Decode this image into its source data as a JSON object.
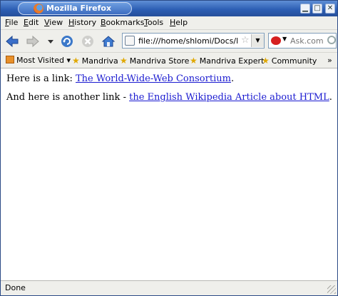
{
  "window": {
    "title": "Mozilla Firefox",
    "controls": {
      "minimize": "▁",
      "maximize": "□",
      "close": "✕"
    }
  },
  "menu": [
    "File",
    "Edit",
    "View",
    "History",
    "Bookmarks",
    "Tools",
    "Help"
  ],
  "navigation": {
    "url": "file:///home/shlomi/Docs/lectu",
    "search_placeholder": "Ask.com"
  },
  "bookmarks": [
    {
      "label": "Most Visited",
      "icon": "most-visited-icon",
      "dropdown": true
    },
    {
      "label": "Mandriva",
      "icon": "star-icon"
    },
    {
      "label": "Mandriva Store",
      "icon": "star-icon"
    },
    {
      "label": "Mandriva Expert",
      "icon": "star-icon"
    },
    {
      "label": "Community",
      "icon": "star-icon"
    }
  ],
  "bookmarks_overflow": "»",
  "content": {
    "line1": {
      "prefix": "Here is a link: ",
      "link": "The World-Wide-Web Consortium",
      "suffix": "."
    },
    "line2": {
      "prefix": "And here is another link - ",
      "link": "the English Wikipedia Article about HTML",
      "suffix": "."
    }
  },
  "status": "Done",
  "colors": {
    "titlebar": "#2d5fb4",
    "link": "#1a1ad0",
    "chrome": "#efefeb"
  }
}
